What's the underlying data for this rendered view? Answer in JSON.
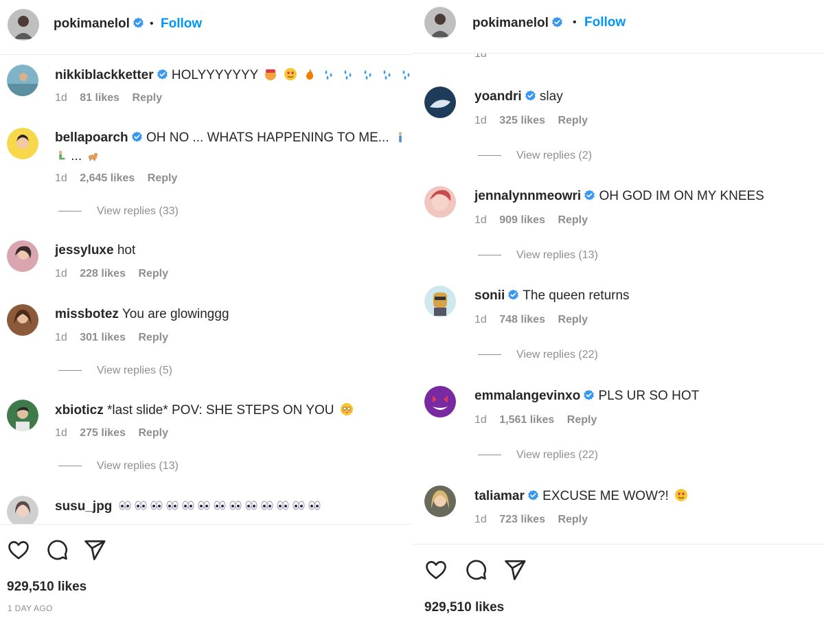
{
  "colors": {
    "accent": "#0095f6",
    "verified": "#3897f0",
    "text": "#262626",
    "muted": "#8e8e8e"
  },
  "post": {
    "username": "pokimanelol",
    "separator": "•",
    "follow_label": "Follow",
    "likes": "929,510 likes",
    "timestamp": "1 DAY AGO"
  },
  "left_comments": [
    {
      "user": "nikkiblackketter",
      "verified": true,
      "text": "HOLYYYYYYY",
      "time": "1d",
      "likes": "81 likes",
      "reply": "Reply"
    },
    {
      "user": "bellapoarch",
      "verified": true,
      "text": "OH NO ... WHATS HAPPENING TO ME...",
      "text2": "...",
      "time": "1d",
      "likes": "2,645 likes",
      "reply": "Reply",
      "view_replies": "View replies (33)"
    },
    {
      "user": "jessyluxe",
      "verified": false,
      "text": "hot",
      "time": "1d",
      "likes": "228 likes",
      "reply": "Reply"
    },
    {
      "user": "missbotez",
      "verified": false,
      "text": "You are glowinggg",
      "time": "1d",
      "likes": "301 likes",
      "reply": "Reply",
      "view_replies": "View replies (5)"
    },
    {
      "user": "xbioticz",
      "verified": false,
      "text": "*last slide* POV: SHE STEPS ON YOU",
      "time": "1d",
      "likes": "275 likes",
      "reply": "Reply",
      "view_replies": "View replies (13)"
    },
    {
      "user": "susu_jpg",
      "verified": false,
      "text": ""
    }
  ],
  "right_comments": [
    {
      "time_partial": "1d"
    },
    {
      "user": "yoandri",
      "verified": true,
      "text": "slay",
      "time": "1d",
      "likes": "325 likes",
      "reply": "Reply",
      "view_replies": "View replies (2)"
    },
    {
      "user": "jennalynnmeowri",
      "verified": true,
      "text": "OH GOD IM ON MY KNEES",
      "time": "1d",
      "likes": "909 likes",
      "reply": "Reply",
      "view_replies": "View replies (13)"
    },
    {
      "user": "sonii",
      "verified": true,
      "text": "The queen returns",
      "time": "1d",
      "likes": "748 likes",
      "reply": "Reply",
      "view_replies": "View replies (22)"
    },
    {
      "user": "emmalangevinxo",
      "verified": true,
      "text": "PLS UR SO HOT",
      "time": "1d",
      "likes": "1,561 likes",
      "reply": "Reply",
      "view_replies": "View replies (22)"
    },
    {
      "user": "taliamar",
      "verified": true,
      "text": "EXCUSE ME WOW?!",
      "time": "1d",
      "likes": "723 likes",
      "reply": "Reply"
    }
  ],
  "icons": [
    "heart-icon",
    "comment-icon",
    "share-icon",
    "verified-badge-icon"
  ]
}
